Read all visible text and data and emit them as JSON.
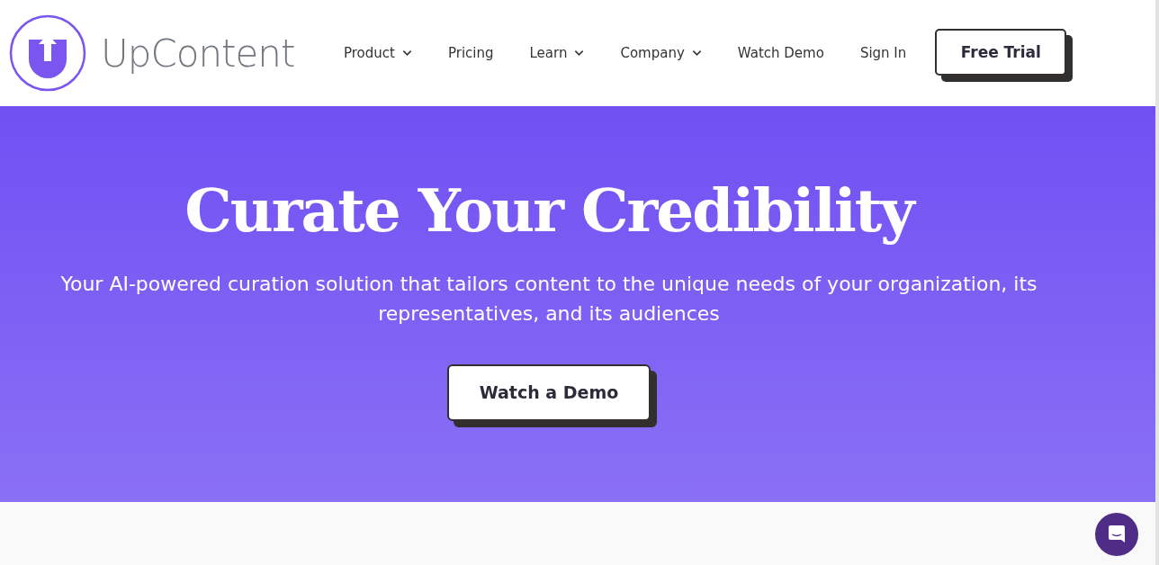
{
  "header": {
    "logo_text": "UpContent",
    "nav": [
      {
        "label": "Product",
        "has_menu": true
      },
      {
        "label": "Pricing",
        "has_menu": false
      },
      {
        "label": "Learn",
        "has_menu": true
      },
      {
        "label": "Company",
        "has_menu": true
      },
      {
        "label": "Watch Demo",
        "has_menu": false
      },
      {
        "label": "Sign In",
        "has_menu": false
      }
    ],
    "cta": "Free Trial"
  },
  "hero": {
    "title": "Curate Your Credibility",
    "subtitle": "Your AI-powered curation solution that tailors content to the unique needs of your organization, its representatives, and its audiences",
    "button": "Watch a Demo"
  }
}
